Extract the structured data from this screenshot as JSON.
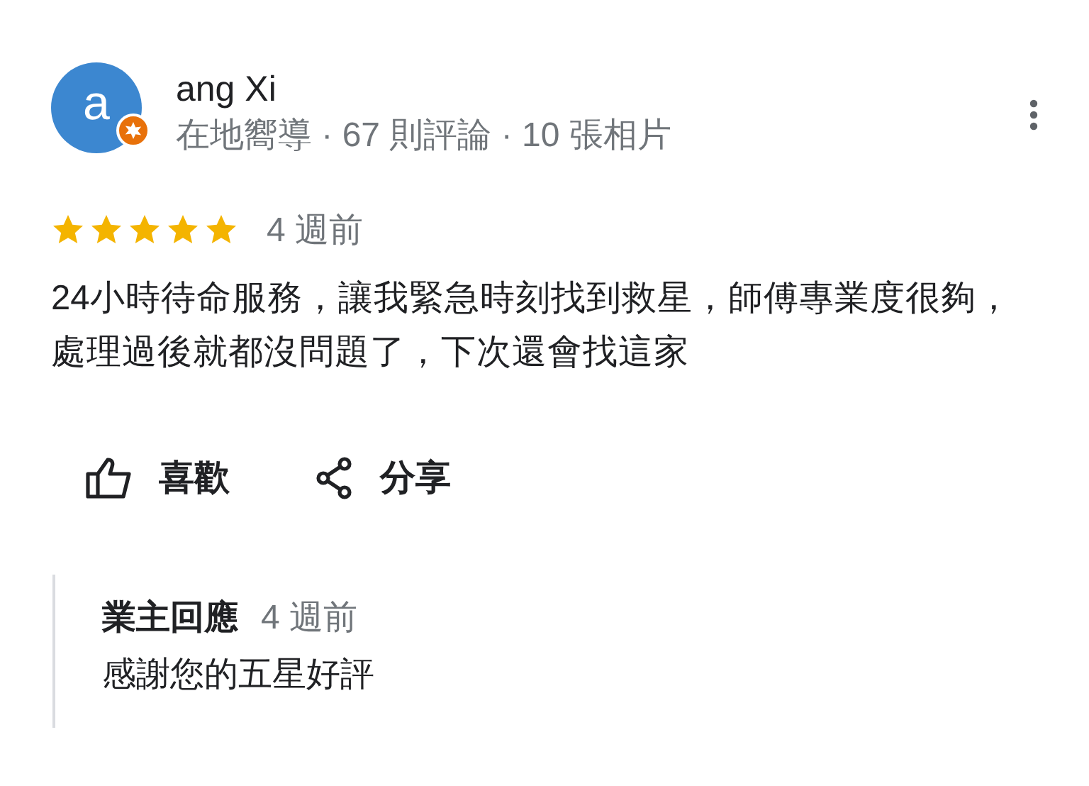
{
  "reviewer": {
    "avatar_letter": "a",
    "name": "ang Xi",
    "meta": "在地嚮導 · 67 則評論 · 10 張相片"
  },
  "review": {
    "stars": 5,
    "time": "4 週前",
    "text": "24小時待命服務，讓我緊急時刻找到救星，師傅專業度很夠，處理過後就都沒問題了，下次還會找這家"
  },
  "actions": [
    {
      "kind": "like",
      "label": "喜歡"
    },
    {
      "kind": "share",
      "label": "分享"
    }
  ],
  "owner_reply": {
    "title": "業主回應",
    "time": "4 週前",
    "text": "感謝您的五星好評"
  }
}
